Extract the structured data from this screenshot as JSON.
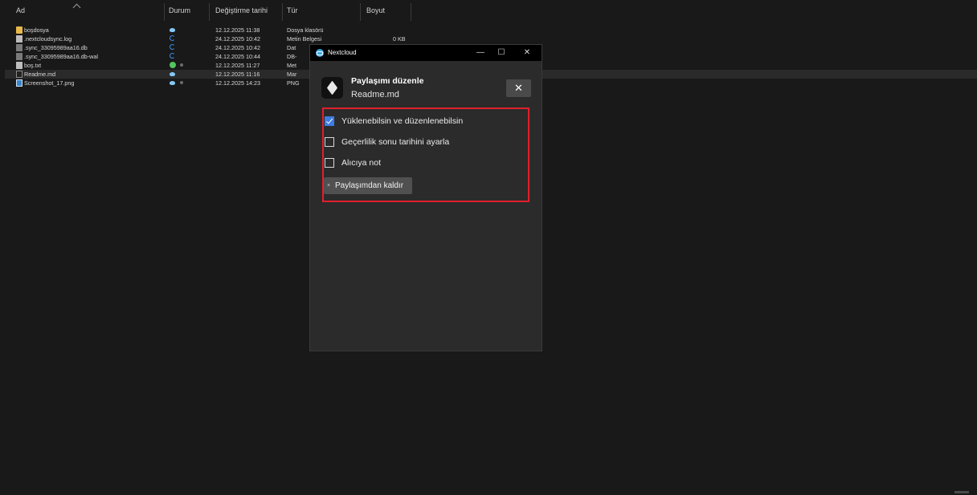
{
  "explorer": {
    "columns": {
      "name": "Ad",
      "status": "Durum",
      "modified": "Değiştirme tarihi",
      "type": "Tür",
      "size": "Boyut"
    },
    "rows": [
      {
        "name": "boşdosya",
        "modified": "12.12.2025 11:38",
        "type": "Dosya klasörü",
        "size": "",
        "icon": "folder-icon",
        "status": "cloud-icon"
      },
      {
        "name": ".nextcloudsync.log",
        "modified": "24.12.2025 10:42",
        "type": "Metin Belgesi",
        "size": "0 KB",
        "icon": "document-icon",
        "status": "sync-icon"
      },
      {
        "name": ".sync_33095989aa16.db",
        "modified": "24.12.2025 10:42",
        "type": "Dat",
        "size": "",
        "icon": "database-file-icon",
        "status": "sync-icon"
      },
      {
        "name": ".sync_33095989aa16.db-wal",
        "modified": "24.12.2025 10:44",
        "type": "DB-",
        "size": "",
        "icon": "database-file-icon",
        "status": "sync-icon"
      },
      {
        "name": "boş.txt",
        "modified": "12.12.2025 11:27",
        "type": "Met",
        "size": "",
        "icon": "text-file-icon",
        "status": "synced-check-icon"
      },
      {
        "name": "Readme.md",
        "modified": "12.12.2025 11:16",
        "type": "Mar",
        "size": "",
        "icon": "markdown-file-icon",
        "status": "cloud-icon"
      },
      {
        "name": "Screenshot_17.png",
        "modified": "12.12.2025 14:23",
        "type": "PNG",
        "size": "",
        "icon": "image-file-icon",
        "status": "cloud-icon"
      }
    ]
  },
  "dialog": {
    "window_title": "Nextcloud",
    "controls": {
      "minimize": "—",
      "maximize": "☐",
      "close": "✕"
    },
    "title": "Paylaşımı düzenle",
    "filename": "Readme.md",
    "close_label": "✕",
    "options": [
      {
        "label": "Yüklenebilsin ve düzenlenebilsin",
        "checked": true
      },
      {
        "label": "Geçerlilik sonu tarihini ayarla",
        "checked": false
      },
      {
        "label": "Alıcıya not",
        "checked": false
      }
    ],
    "unshare_icon": "×",
    "unshare_label": "Paylaşımdan kaldır",
    "highlight_color": "#e0202d",
    "accent_color": "#3d7de4"
  }
}
